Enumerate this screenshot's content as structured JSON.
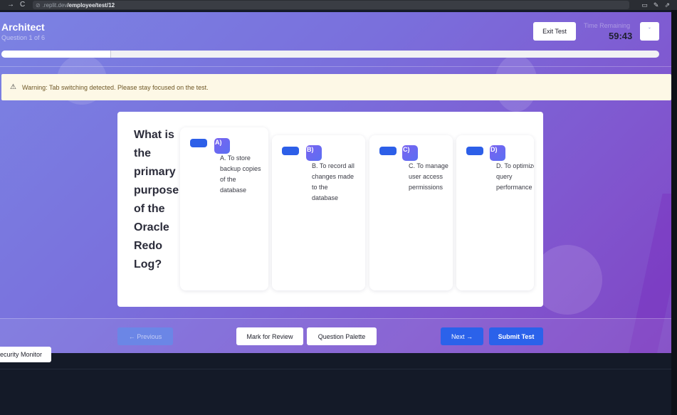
{
  "browser": {
    "back_icon": "→",
    "reload_icon": "C",
    "url_host": ".replit.dev",
    "url_path": "/employee/test/12"
  },
  "header": {
    "title": "Architect",
    "subtitle": "Question 1 of 6",
    "exit_label": "Exit Test",
    "time_label": "Time Remaining",
    "time_value": "59:43"
  },
  "progress": {
    "value": 0.167
  },
  "warning": {
    "icon": "⚠",
    "text": "Warning: Tab switching detected. Please stay focused on the test."
  },
  "question": {
    "text": "What is the primary purpose of the Oracle Redo Log?",
    "options": [
      {
        "badge": "A)",
        "text": "A. To store backup copies of the database"
      },
      {
        "badge": "B)",
        "text": "B. To record all changes made to the database"
      },
      {
        "badge": "C)",
        "text": "C. To manage user access permissions"
      },
      {
        "badge": "D)",
        "text": "D. To optimize query performance"
      }
    ]
  },
  "footer": {
    "previous_label": "← Previous",
    "mark_label": "Mark for Review",
    "palette_label": "Question Palette",
    "next_label": "Next →",
    "submit_label": "Submit Test"
  },
  "security_monitor": {
    "label": "Security Monitor"
  }
}
